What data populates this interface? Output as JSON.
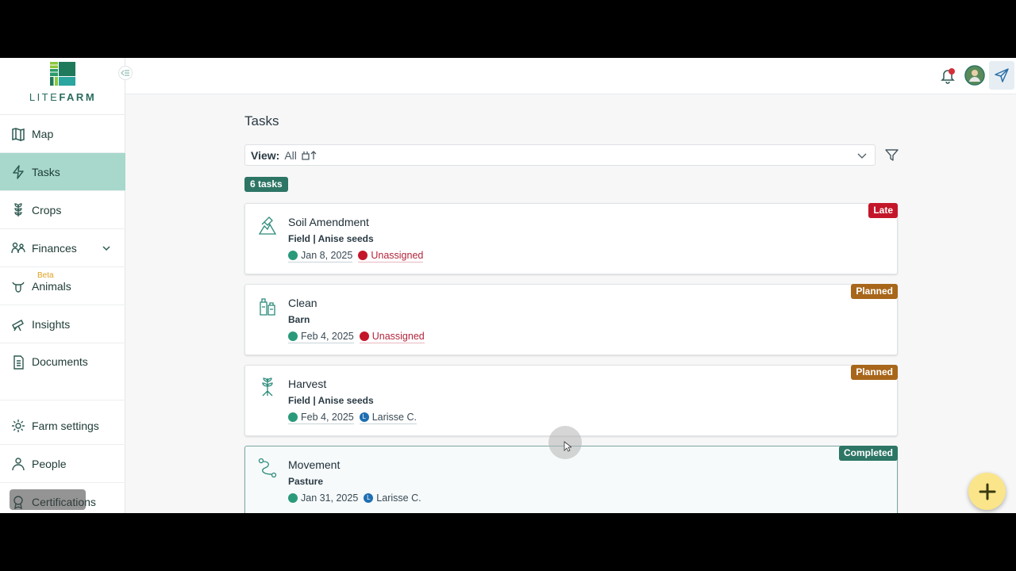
{
  "brand": {
    "name_light": "LITE",
    "name_bold": "FARM"
  },
  "sidebar": {
    "items": [
      {
        "label": "Map",
        "icon": "map-icon"
      },
      {
        "label": "Tasks",
        "icon": "bolt-icon"
      },
      {
        "label": "Crops",
        "icon": "crop-icon"
      },
      {
        "label": "Finances",
        "icon": "finance-icon"
      },
      {
        "label": "Animals",
        "icon": "animal-icon",
        "badge": "Beta"
      },
      {
        "label": "Insights",
        "icon": "telescope-icon"
      },
      {
        "label": "Documents",
        "icon": "document-icon"
      },
      {
        "label": "Farm settings",
        "icon": "gear-icon"
      },
      {
        "label": "People",
        "icon": "people-icon"
      },
      {
        "label": "Certifications",
        "icon": "certification-icon"
      }
    ]
  },
  "main": {
    "title": "Tasks",
    "view": {
      "label": "View:",
      "value": "All"
    },
    "count": "6 tasks",
    "tasks": [
      {
        "title": "Soil Amendment",
        "location": "Field | Anise seeds",
        "date": "Jan 8, 2025",
        "assignee": "Unassigned",
        "status": "Late"
      },
      {
        "title": "Clean",
        "location": "Barn",
        "date": "Feb 4, 2025",
        "assignee": "Unassigned",
        "status": "Planned"
      },
      {
        "title": "Harvest",
        "location": "Field | Anise seeds",
        "date": "Feb 4, 2025",
        "assignee": "Larisse C.",
        "assignee_initial": "L",
        "status": "Planned"
      },
      {
        "title": "Movement",
        "location": "Pasture",
        "date": "Jan 31, 2025",
        "assignee": "Larisse C.",
        "assignee_initial": "L",
        "status": "Completed"
      }
    ]
  },
  "colors": {
    "accent": "#2d7565",
    "active_nav": "#a7d8cb",
    "late": "#c4162a",
    "planned": "#a8661a",
    "fab": "#fbe58a"
  }
}
